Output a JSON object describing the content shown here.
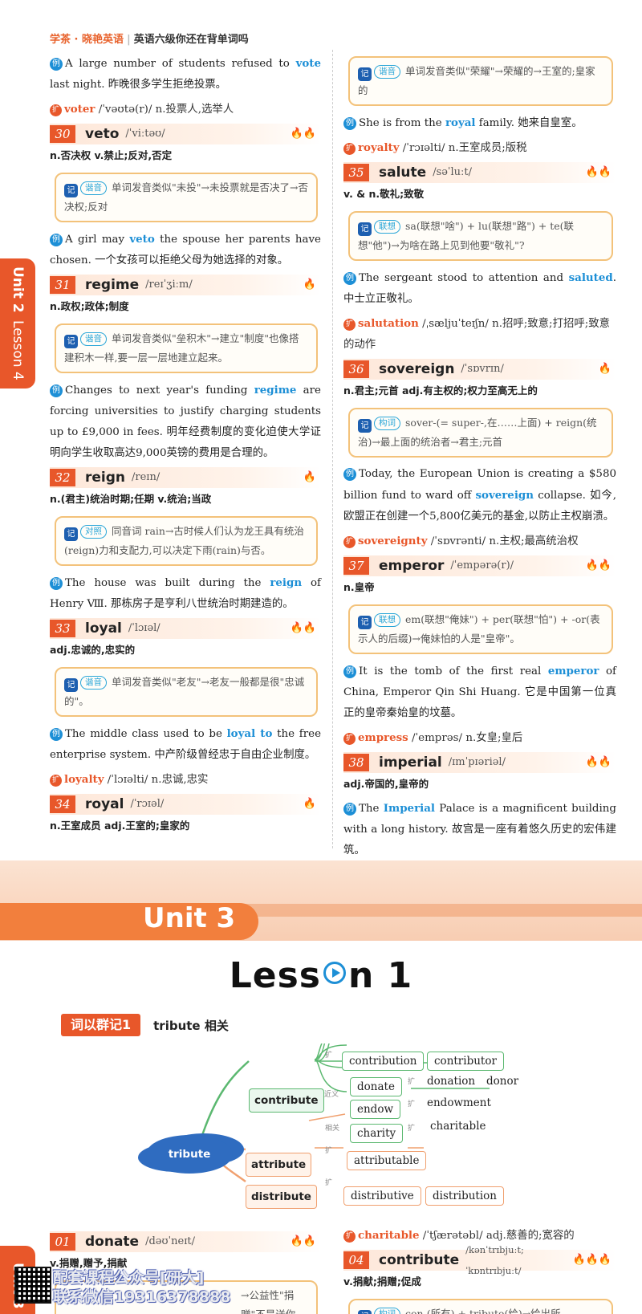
{
  "header": {
    "brand": "学茶 · 晓艳英语",
    "book": "英语六级你还在背单词吗"
  },
  "sidetab": {
    "unit": "Unit 2",
    "lesson": "Lesson 4",
    "bottom": "Unit 3"
  },
  "left_column": {
    "ex_vote": {
      "label": "例",
      "pre": "A large number of students refused to ",
      "hl": "vote",
      "post": " last night. 昨晚很多学生拒绝投票。"
    },
    "ext_voter": {
      "label": "扩",
      "word": "voter",
      "rest": " /ˈvəʊtə(r)/  n.投票人,选举人"
    },
    "e30": {
      "num": "30",
      "word": "veto",
      "ipa": "/ˈviːtəʊ/",
      "flames": "🔥🔥",
      "def": "n.否决权  v.禁止;反对,否定",
      "tip_tag": "谐音",
      "tip": "单词发音类似\"未投\"→未投票就是否决了→否决权;反对"
    },
    "ex_veto": {
      "label": "例",
      "pre": "A girl may ",
      "hl": "veto",
      "post": " the spouse her parents have chosen. 一个女孩可以拒绝父母为她选择的对象。"
    },
    "e31": {
      "num": "31",
      "word": "regime",
      "ipa": "/reɪˈʒiːm/",
      "flames": "🔥",
      "def": "n.政权;政体;制度",
      "tip_tag": "谐音",
      "tip": "单词发音类似\"垒积木\"→建立\"制度\"也像搭建积木一样,要一层一层地建立起来。"
    },
    "ex_regime": {
      "label": "例",
      "pre": "Changes to next year's funding ",
      "hl": "regime",
      "post": " are forcing universities to justify charging students up to £9,000 in fees. 明年经费制度的变化迫使大学证明向学生收取高达9,000英镑的费用是合理的。"
    },
    "e32": {
      "num": "32",
      "word": "reign",
      "ipa": "/reɪn/",
      "flames": "🔥",
      "def": "n.(君主)统治时期;任期  v.统治;当政",
      "tip_tag": "对照",
      "tip": "同音词 rain→古时候人们认为龙王具有统治(reign)力和支配力,可以决定下雨(rain)与否。"
    },
    "ex_reign": {
      "label": "例",
      "pre": "The house was built during the ",
      "hl": "reign",
      "post": " of Henry Ⅷ. 那栋房子是亨利八世统治时期建造的。"
    },
    "e33": {
      "num": "33",
      "word": "loyal",
      "ipa": "/ˈlɔɪəl/",
      "flames": "🔥🔥",
      "def": "adj.忠诚的,忠实的",
      "tip_tag": "谐音",
      "tip": "单词发音类似\"老友\"→老友一般都是很\"忠诚的\"。"
    },
    "ex_loyal": {
      "label": "例",
      "pre": "The middle class used to be ",
      "hl": "loyal to",
      "post": " the free enterprise system. 中产阶级曾经忠于自由企业制度。"
    },
    "ext_loyalty": {
      "label": "扩",
      "word": "loyalty",
      "rest": " /ˈlɔɪəlti/  n.忠诚,忠实"
    },
    "e34": {
      "num": "34",
      "word": "royal",
      "ipa": "/ˈrɔɪəl/",
      "flames": "🔥",
      "def": "n.王室成员  adj.王室的;皇家的"
    }
  },
  "right_column": {
    "tip_royal": {
      "tag": "谐音",
      "text": "单词发音类似\"荣耀\"→荣耀的→王室的;皇家的"
    },
    "ex_royal": {
      "label": "例",
      "pre": "She is from the ",
      "hl": "royal",
      "post": " family. 她来自皇室。"
    },
    "ext_royalty": {
      "label": "扩",
      "word": "royalty",
      "rest": " /ˈrɔɪəlti/  n.王室成员;版税"
    },
    "e35": {
      "num": "35",
      "word": "salute",
      "ipa": "/səˈluːt/",
      "flames": "🔥🔥",
      "def": "v. & n.敬礼;致敬",
      "tip_tag": "联想",
      "tip": "sa(联想\"啥\") + lu(联想\"路\") + te(联想\"他\")→为啥在路上见到他要\"敬礼\"?"
    },
    "ex_salute": {
      "label": "例",
      "pre": "The sergeant stood to attention and ",
      "hl": "saluted",
      "post": ". 中士立正敬礼。"
    },
    "ext_salutation": {
      "label": "扩",
      "word": "salutation",
      "rest": " /ˌsæljuˈteɪʃn/  n.招呼;致意;打招呼;致意的动作"
    },
    "e36": {
      "num": "36",
      "word": "sovereign",
      "ipa": "/ˈsɒvrɪn/",
      "flames": "🔥",
      "def": "n.君主;元首  adj.有主权的;权力至高无上的",
      "tip_tag": "构词",
      "tip": "sover-(= super-,在……上面) + reign(统治)→最上面的统治者→君主;元首"
    },
    "ex_sovereign": {
      "label": "例",
      "pre": "Today, the European Union is creating a $580 billion fund to ward off ",
      "hl": "sovereign",
      "post": " collapse. 如今,欧盟正在创建一个5,800亿美元的基金,以防止主权崩溃。"
    },
    "ext_sovereignty": {
      "label": "扩",
      "word": "sovereignty",
      "rest": " /ˈsɒvrənti/  n.主权;最高统治权"
    },
    "e37": {
      "num": "37",
      "word": "emperor",
      "ipa": "/ˈempərə(r)/",
      "flames": "🔥🔥",
      "def": "n.皇帝",
      "tip_tag": "联想",
      "tip": "em(联想\"俺妹\") + per(联想\"怕\") + -or(表示人的后缀)→俺妹怕的人是\"皇帝\"。"
    },
    "ex_emperor": {
      "label": "例",
      "pre": "It is the tomb of the first real ",
      "hl": "emperor",
      "post": " of China, Emperor Qin Shi Huang. 它是中国第一位真正的皇帝秦始皇的坟墓。"
    },
    "ext_empress": {
      "label": "扩",
      "word": "empress",
      "rest": " /ˈemprəs/  n.女皇;皇后"
    },
    "e38": {
      "num": "38",
      "word": "imperial",
      "ipa": "/ɪmˈpɪəriəl/",
      "flames": "🔥🔥",
      "def": "adj.帝国的,皇帝的"
    },
    "ex_imperial": {
      "label": "例",
      "pre": "The ",
      "hl": "Imperial",
      "post": " Palace is a magnificent building with a long history. 故宫是一座有着悠久历史的宏伟建筑。"
    }
  },
  "unit_banner": {
    "unit": "Unit 3",
    "lesson_a": "Less",
    "lesson_b": "n 1"
  },
  "group": {
    "title": "词以群记1",
    "word": "tribute",
    "suffix": "相关"
  },
  "mindmap": {
    "root": "tribute",
    "contribute": "contribute",
    "attribute": "attribute",
    "distribute": "distribute",
    "contribution": "contribution",
    "contributor": "contributor",
    "donate": "donate",
    "donation": "donation",
    "donor": "donor",
    "endow": "endow",
    "endowment": "endowment",
    "charity": "charity",
    "charitable": "charitable",
    "attributable": "attributable",
    "distributive": "distributive",
    "distribution": "distribution",
    "tag_ext": "扩",
    "tag_near": "近义",
    "tag_rel": "相关"
  },
  "bottom": {
    "e01": {
      "num": "01",
      "word": "donate",
      "ipa": "/dəʊˈneɪt/",
      "flames": "🔥🔥",
      "def": "v.捐赠,赠予,捐献",
      "tip_partial": "→公益性\"捐赠\"不是送你的。"
    },
    "ext_charitable": {
      "label": "扩",
      "word": "charitable",
      "rest": " /ˈtʃærətəbl/  adj.慈善的;宽容的"
    },
    "e04": {
      "num": "04",
      "word": "contribute",
      "ipa": "/kənˈtrɪbjuːt; ˈkɒntrɪbjuːt/",
      "flames": "🔥🔥🔥",
      "def": "v.捐献;捐赠;促成",
      "tip_tag": "构词",
      "tip": "con-(所有) + tribute(给)→给出所"
    }
  },
  "watermark": {
    "line1": "配套课程公众号[研大]",
    "line2": "联系微信19316378888"
  }
}
